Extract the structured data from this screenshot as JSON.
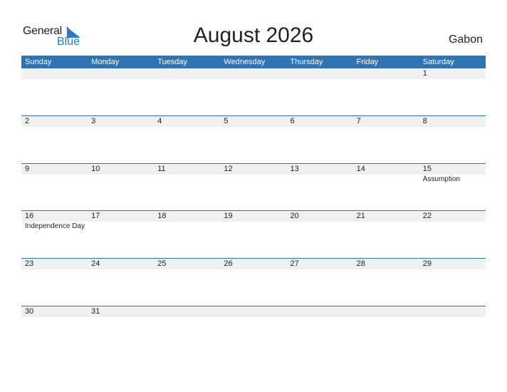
{
  "logo": {
    "general": "General",
    "blue": "Blue"
  },
  "title": "August 2026",
  "country": "Gabon",
  "weekdays": [
    "Sunday",
    "Monday",
    "Tuesday",
    "Wednesday",
    "Thursday",
    "Friday",
    "Saturday"
  ],
  "weeks": [
    {
      "days": [
        "",
        "",
        "",
        "",
        "",
        "",
        "1"
      ],
      "holidays": [
        "",
        "",
        "",
        "",
        "",
        "",
        ""
      ]
    },
    {
      "days": [
        "2",
        "3",
        "4",
        "5",
        "6",
        "7",
        "8"
      ],
      "holidays": [
        "",
        "",
        "",
        "",
        "",
        "",
        ""
      ]
    },
    {
      "days": [
        "9",
        "10",
        "11",
        "12",
        "13",
        "14",
        "15"
      ],
      "holidays": [
        "",
        "",
        "",
        "",
        "",
        "",
        "Assumption"
      ]
    },
    {
      "days": [
        "16",
        "17",
        "18",
        "19",
        "20",
        "21",
        "22"
      ],
      "holidays": [
        "Independence Day",
        "",
        "",
        "",
        "",
        "",
        ""
      ]
    },
    {
      "days": [
        "23",
        "24",
        "25",
        "26",
        "27",
        "28",
        "29"
      ],
      "holidays": [
        "",
        "",
        "",
        "",
        "",
        "",
        ""
      ]
    },
    {
      "days": [
        "30",
        "31",
        "",
        "",
        "",
        "",
        ""
      ],
      "holidays": [
        "",
        "",
        "",
        "",
        "",
        "",
        ""
      ]
    }
  ],
  "colors": {
    "accent": "#2e73b4",
    "strip": "#f0f0f0",
    "logo_blue": "#2a7bc4"
  }
}
